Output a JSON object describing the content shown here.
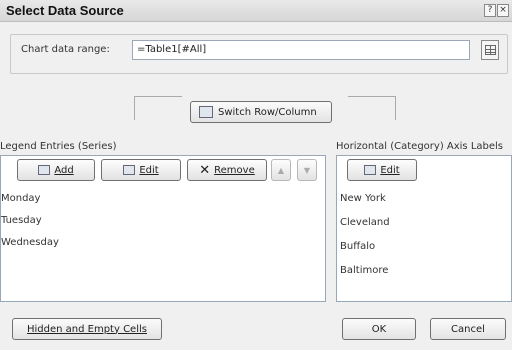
{
  "window": {
    "title": "Select Data Source",
    "help_glyph": "?",
    "close_glyph": "×"
  },
  "range": {
    "label": "Chart data range:",
    "value": "=Table1[#All]"
  },
  "switch_button": {
    "label": "Switch Row/Column"
  },
  "legend": {
    "label": "Legend Entries (Series)",
    "add_label": "Add",
    "edit_label": "Edit",
    "remove_label": "Remove",
    "up_glyph": "▲",
    "down_glyph": "▼",
    "items": [
      "Monday",
      "Tuesday",
      "Wednesday"
    ]
  },
  "axis": {
    "label": "Horizontal (Category) Axis Labels",
    "edit_label": "Edit",
    "items": [
      "New York",
      "Cleveland",
      "Buffalo",
      "Baltimore"
    ]
  },
  "footer": {
    "hidden_cells_label": "Hidden and Empty Cells",
    "ok_label": "OK",
    "cancel_label": "Cancel"
  },
  "icons": {
    "add": "add-series-icon",
    "edit": "edit-icon",
    "remove": "remove-x-icon",
    "switch": "switch-row-column-icon",
    "range": "collapse-dialog-icon"
  }
}
